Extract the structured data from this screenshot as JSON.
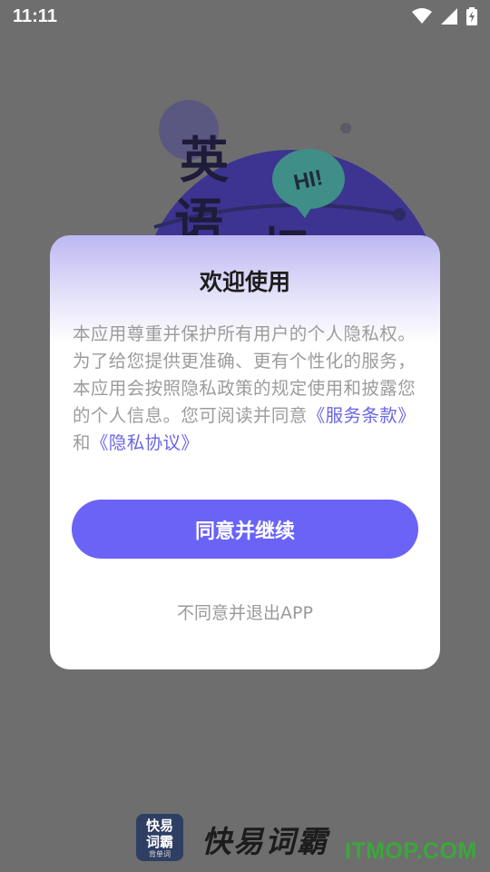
{
  "status_bar": {
    "time": "11:11"
  },
  "background": {
    "chars": [
      "英",
      "语",
      "权"
    ],
    "speech_bubble": "HI!"
  },
  "dialog": {
    "title": "欢迎使用",
    "body_text": "本应用尊重并保护所有用户的个人隐私权。为了给您提供更准确、更有个性化的服务，本应用会按照隐私政策的规定使用和披露您的个人信息。您可阅读并同意",
    "terms_link": "《服务条款》",
    "and_text": "和",
    "privacy_link": "《隐私协议》",
    "agree_label": "同意并继续",
    "disagree_label": "不同意并退出APP"
  },
  "brand": {
    "logo_line1": "快易",
    "logo_line2": "词霸",
    "logo_line3": "背单词",
    "name": "快易词霸",
    "watermark": "ITMOP.COM"
  },
  "colors": {
    "accent": "#6a63f6",
    "link": "#6a64e6",
    "overlay": "#6f6f6f",
    "watermark": "#3aa83a"
  }
}
